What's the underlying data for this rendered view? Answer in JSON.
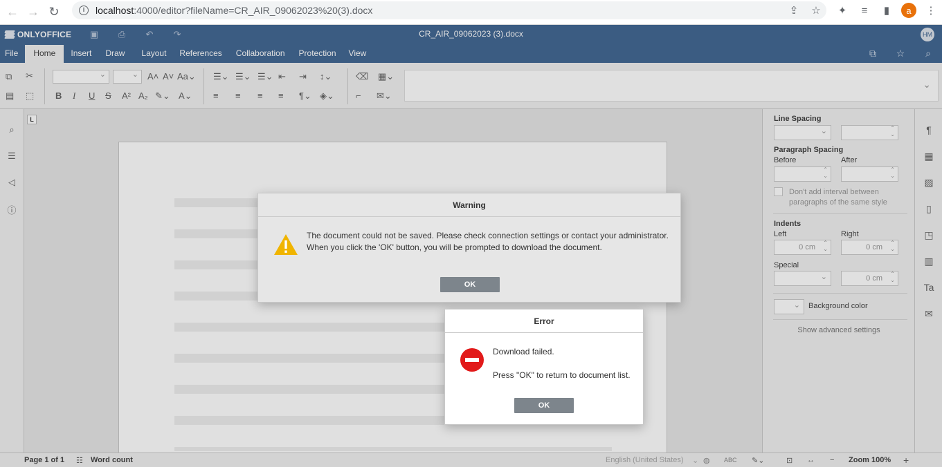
{
  "browser": {
    "url_host": "localhost",
    "url_rest": ":4000/editor?fileName=CR_AIR_09062023%20(3).docx",
    "profile_initial": "a"
  },
  "app": {
    "brand": "ONLYOFFICE",
    "doc_title": "CR_AIR_09062023 (3).docx",
    "user_initials": "HM",
    "tabs": [
      "File",
      "Home",
      "Insert",
      "Draw",
      "Layout",
      "References",
      "Collaboration",
      "Protection",
      "View"
    ],
    "active_tab": "Home"
  },
  "right_panel": {
    "line_spacing": "Line Spacing",
    "paragraph_spacing": "Paragraph Spacing",
    "before": "Before",
    "after": "After",
    "dont_add_interval": "Don't add interval between paragraphs of the same style",
    "indents": "Indents",
    "left": "Left",
    "right": "Right",
    "left_value": "0 cm",
    "right_value": "0 cm",
    "special": "Special",
    "special_value": "0 cm",
    "background_color": "Background color",
    "show_advanced": "Show advanced settings"
  },
  "status": {
    "page": "Page 1 of 1",
    "word_count": "Word count",
    "language": "English (United States)",
    "zoom": "Zoom 100%"
  },
  "warning_dialog": {
    "title": "Warning",
    "line1": "The document could not be saved. Please check connection settings or contact your administrator.",
    "line2": "When you click the 'OK' button, you will be prompted to download the document.",
    "ok": "OK"
  },
  "error_dialog": {
    "title": "Error",
    "line1": "Download failed.",
    "line2": "Press \"OK\" to return to document list.",
    "ok": "OK"
  },
  "colors": {
    "header_bg": "#446995",
    "error_red": "#e21a1a",
    "warning_yellow": "#f0b400",
    "button_gray": "#7d858c"
  }
}
